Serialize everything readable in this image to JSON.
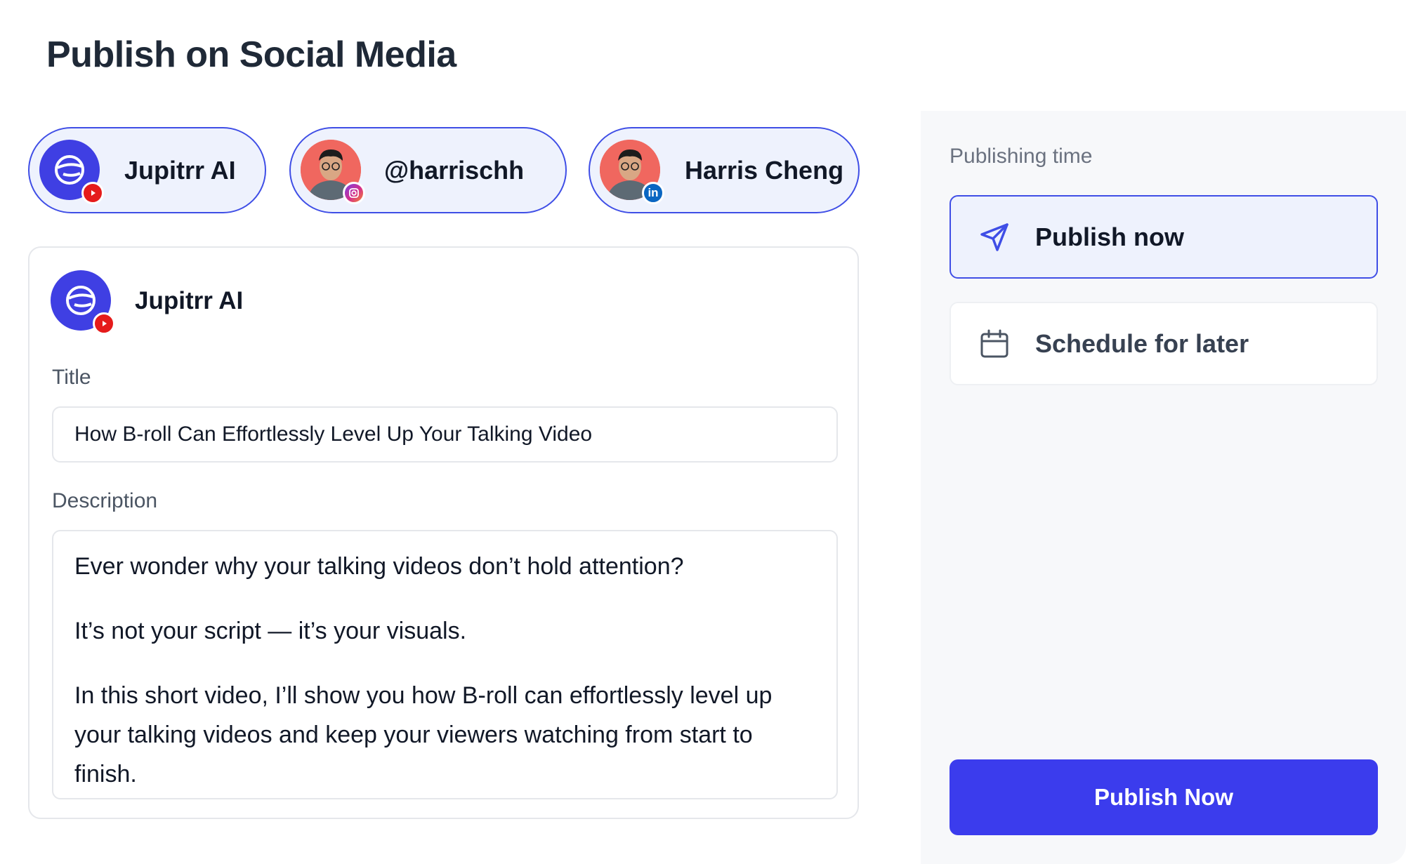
{
  "page": {
    "title": "Publish on Social Media"
  },
  "accounts": [
    {
      "name": "Jupitrr AI",
      "platform": "youtube",
      "selected": true
    },
    {
      "name": "@harrischh",
      "platform": "instagram",
      "selected": true
    },
    {
      "name": "Harris Cheng",
      "platform": "linkedin",
      "selected": true
    }
  ],
  "post": {
    "account_name": "Jupitrr AI",
    "title_label": "Title",
    "title_value": "How B-roll Can Effortlessly Level Up Your Talking Video",
    "description_label": "Description",
    "description_paragraphs": [
      "Ever wonder why your talking videos don’t hold attention?",
      "It’s not your script — it’s your visuals.",
      "In this short video, I’ll show you how B-roll can effortlessly level up your talking videos and keep your viewers watching from start to finish."
    ]
  },
  "publishing": {
    "label": "Publishing time",
    "options": [
      {
        "label": "Publish now",
        "icon": "send-icon",
        "selected": true
      },
      {
        "label": "Schedule for later",
        "icon": "calendar-icon",
        "selected": false
      }
    ],
    "submit_label": "Publish Now"
  },
  "colors": {
    "accent": "#3b3ced",
    "selected_bg": "#eef2fd",
    "youtube": "#e51b1b",
    "linkedin": "#0a66c2"
  },
  "badges": {
    "linkedin_text": "in"
  }
}
